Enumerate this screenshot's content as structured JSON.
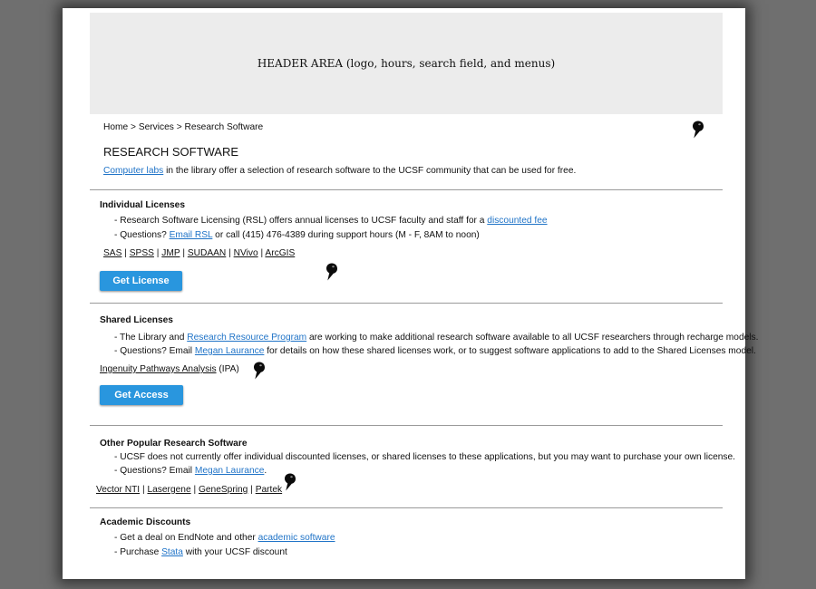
{
  "header": {
    "placeholder_text": "HEADER AREA (logo, hours, search field, and menus)"
  },
  "breadcrumb": {
    "home": "Home",
    "services": "Services",
    "current": "Research Software",
    "sep": ">"
  },
  "page_title": "RESEARCH SOFTWARE",
  "intro": {
    "link": "Computer labs",
    "text": " in the library offer a selection of research software to the UCSF community that can be used for free."
  },
  "individual": {
    "heading": "Individual Licenses",
    "bullet1_text": "- Research Software Licensing (RSL) offers annual licenses to UCSF faculty and staff for a ",
    "bullet1_link": "discounted fee",
    "bullet2_pre": "- Questions? ",
    "bullet2_link": "Email RSL",
    "bullet2_post": " or call (415) 476-4389 during support hours (M - F, 8AM to noon)",
    "software": [
      "SAS",
      "SPSS",
      "JMP",
      "SUDAAN",
      "NVivo",
      "ArcGIS"
    ],
    "separator": "|",
    "button": "Get License"
  },
  "shared": {
    "heading": "Shared Licenses",
    "bullet1_pre": "- The Library and ",
    "bullet1_link": "Research Resource Program",
    "bullet1_post": " are working to make additional research software available to all UCSF researchers through recharge models.",
    "bullet2_pre": "- Questions? Email ",
    "bullet2_link": "Megan Laurance",
    "bullet2_post": " for details on how these shared licenses work, or to suggest software applications to add to the Shared Licenses model.",
    "software_link": "Ingenuity Pathways Analysis",
    "software_suffix": " (IPA)",
    "button": "Get Access"
  },
  "other": {
    "heading": "Other Popular Research Software",
    "bullet1": "- UCSF does not currently offer individual discounted licenses, or shared licenses to these applications, but you may want to purchase your own license.",
    "bullet2_pre": "- Questions? Email ",
    "bullet2_link": "Megan Laurance",
    "bullet2_post": ".",
    "software": [
      "Vector NTI",
      "Lasergene",
      "GeneSpring",
      "Partek"
    ]
  },
  "academic": {
    "heading": "Academic Discounts",
    "bullet1_pre": "- Get a deal on EndNote and other ",
    "bullet1_link": "academic software",
    "bullet2_pre": "- Purchase ",
    "bullet2_link": "Stata",
    "bullet2_post": " with your UCSF discount"
  },
  "colors": {
    "link": "#1f73c7",
    "button": "#2996de",
    "header_bg": "#ececec",
    "page_bg": "#6f6f6f"
  },
  "icons": {
    "annotation_marker": "map-pin-icon"
  }
}
